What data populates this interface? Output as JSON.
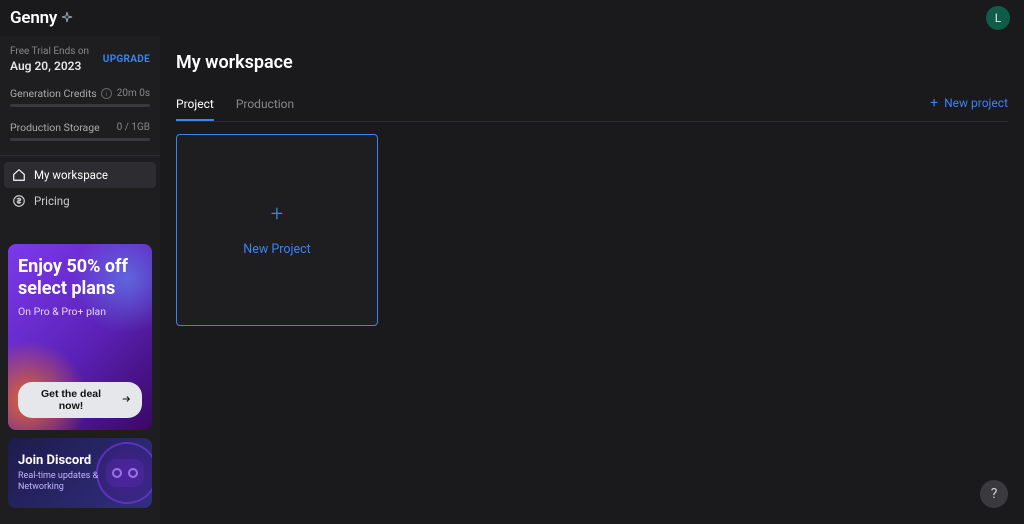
{
  "brand": {
    "name": "Genny",
    "avatar_initial": "L"
  },
  "sidebar": {
    "trial": {
      "label": "Free Trial Ends on",
      "date": "Aug 20, 2023",
      "upgrade": "UPGRADE"
    },
    "credits": {
      "label": "Generation Credits",
      "value": "20m 0s"
    },
    "storage": {
      "label": "Production Storage",
      "value": "0 / 1GB"
    },
    "nav": {
      "workspace": "My workspace",
      "pricing": "Pricing"
    },
    "promo_off": {
      "title": "Enjoy 50% off select plans",
      "subtitle": "On Pro & Pro+ plan",
      "cta": "Get the deal now!"
    },
    "promo_discord": {
      "title": "Join Discord",
      "subtitle": "Real-time updates & Networking"
    }
  },
  "main": {
    "title": "My workspace",
    "tabs": {
      "project": "Project",
      "production": "Production"
    },
    "new_project_link": "New project",
    "new_project_card": "New Project"
  },
  "help": "?"
}
